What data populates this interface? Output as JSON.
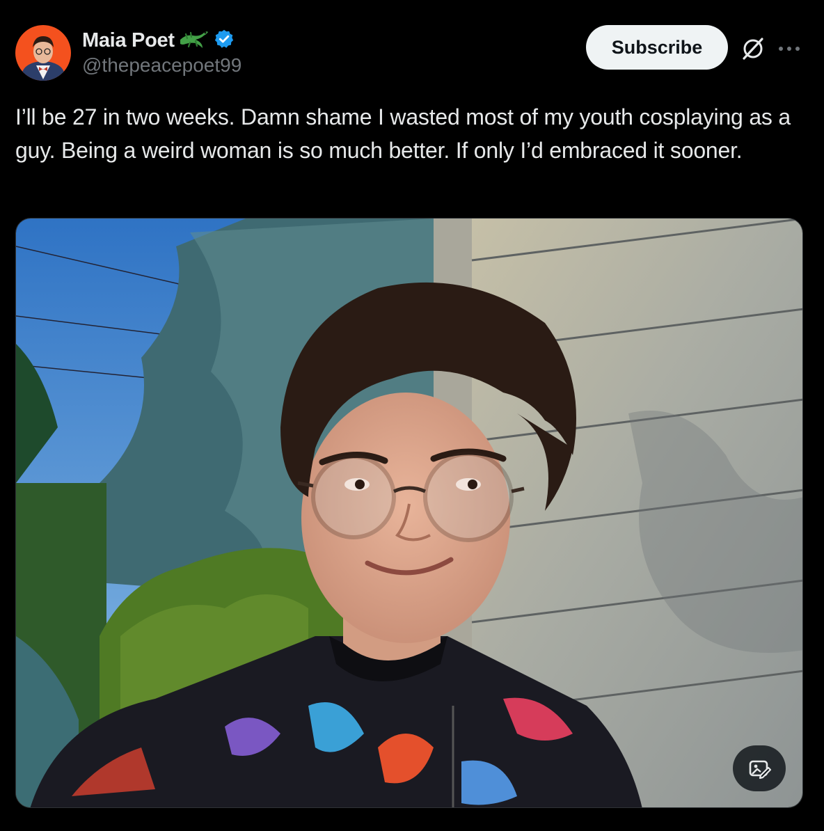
{
  "author": {
    "display_name": "Maia Poet",
    "handle": "@thepeacepoet99",
    "emoji": "lizard-emoji",
    "verified_icon": "verified-badge-icon"
  },
  "actions": {
    "subscribe_label": "Subscribe",
    "grok_icon": "grok-icon",
    "more_icon": "more-icon"
  },
  "tweet": {
    "text": "I’ll be 27 in two weeks. Damn shame I wasted most of my youth cosplaying as a guy. Being a weird woman is so much better. If only I’d embraced it sooner."
  },
  "media": {
    "alt_icon": "image-edit-icon"
  },
  "colors": {
    "background": "#000000",
    "text_primary": "#e7e9ea",
    "text_secondary": "#71767b",
    "verified_blue": "#1d9bf0",
    "avatar_bg": "#f4511e",
    "button_bg": "#eff3f4"
  }
}
